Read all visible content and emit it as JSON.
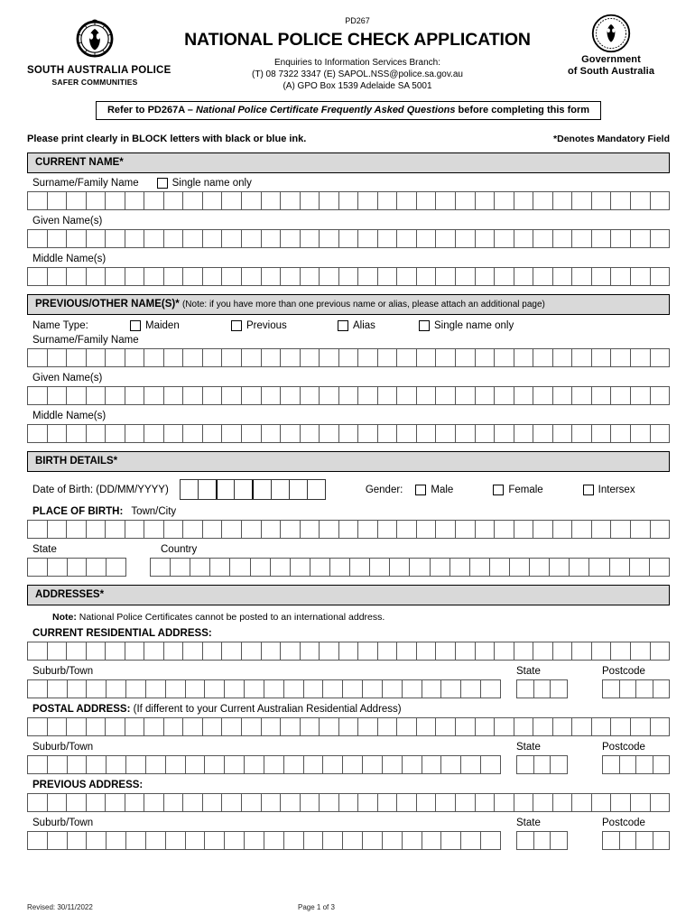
{
  "header": {
    "form_code": "PD267",
    "title": "NATIONAL POLICE CHECK APPLICATION",
    "enquiries_line": "Enquiries to Information Services Branch:",
    "contact_line": "(T) 08 7322 3347  (E) SAPOL.NSS@police.sa.gov.au",
    "address_line": "(A) GPO Box 1539 Adelaide  SA  5001",
    "logo_left": {
      "name": "SOUTH AUSTRALIA POLICE",
      "tagline": "SAFER COMMUNITIES"
    },
    "logo_right": {
      "line1": "Government",
      "line2": "of South Australia"
    }
  },
  "refer_banner": {
    "prefix": "Refer to PD267A – ",
    "italic": "National Police Certificate Frequently Asked Questions",
    "suffix": " before completing this form"
  },
  "instructions": {
    "print_clearly": "Please print clearly in BLOCK letters with black or blue ink.",
    "mandatory_note": "*Denotes Mandatory Field"
  },
  "sections": {
    "current_name": {
      "heading": "CURRENT NAME*",
      "surname_label": "Surname/Family Name",
      "single_name_only": "Single name only",
      "given_label": "Given Name(s)",
      "middle_label": "Middle Name(s)",
      "surname_boxes": 33,
      "given_boxes": 33,
      "middle_boxes": 33
    },
    "previous_name": {
      "heading": "PREVIOUS/OTHER NAME(S)*",
      "heading_note": "(Note: if you have more than one previous name or alias, please attach an additional page)",
      "name_type_label": "Name Type:",
      "type_options": [
        "Maiden",
        "Previous",
        "Alias",
        "Single name only"
      ],
      "surname_label": "Surname/Family Name",
      "given_label": "Given Name(s)",
      "middle_label": "Middle Name(s)",
      "surname_boxes": 33,
      "given_boxes": 33,
      "middle_boxes": 33
    },
    "birth_details": {
      "heading": "BIRTH DETAILS*",
      "dob_label": "Date of Birth: (DD/MM/YYYY)",
      "dob_boxes": 8,
      "gender_label": "Gender:",
      "gender_options": [
        "Male",
        "Female",
        "Intersex"
      ],
      "place_of_birth_label": "PLACE OF BIRTH:",
      "town_city_label": "Town/City",
      "town_boxes": 33,
      "state_label": "State",
      "state_boxes": 5,
      "country_label": "Country",
      "country_boxes": 26
    },
    "addresses": {
      "heading": "ADDRESSES*",
      "note_prefix": "Note:",
      "note_text": " National Police Certificates cannot be posted to an international address.",
      "current_label": "CURRENT RESIDENTIAL ADDRESS:",
      "postal_label_bold": "POSTAL ADDRESS:",
      "postal_label_note": " (If different to your Current Australian Residential Address)",
      "previous_label": "PREVIOUS ADDRESS:",
      "suburb_label": "Suburb/Town",
      "state_label": "State",
      "postcode_label": "Postcode",
      "address_boxes": 33,
      "suburb_boxes": 24,
      "state_boxes": 3,
      "postcode_boxes": 4
    }
  },
  "footer": {
    "revised": "Revised: 30/11/2022",
    "page": "Page 1 of 3"
  }
}
